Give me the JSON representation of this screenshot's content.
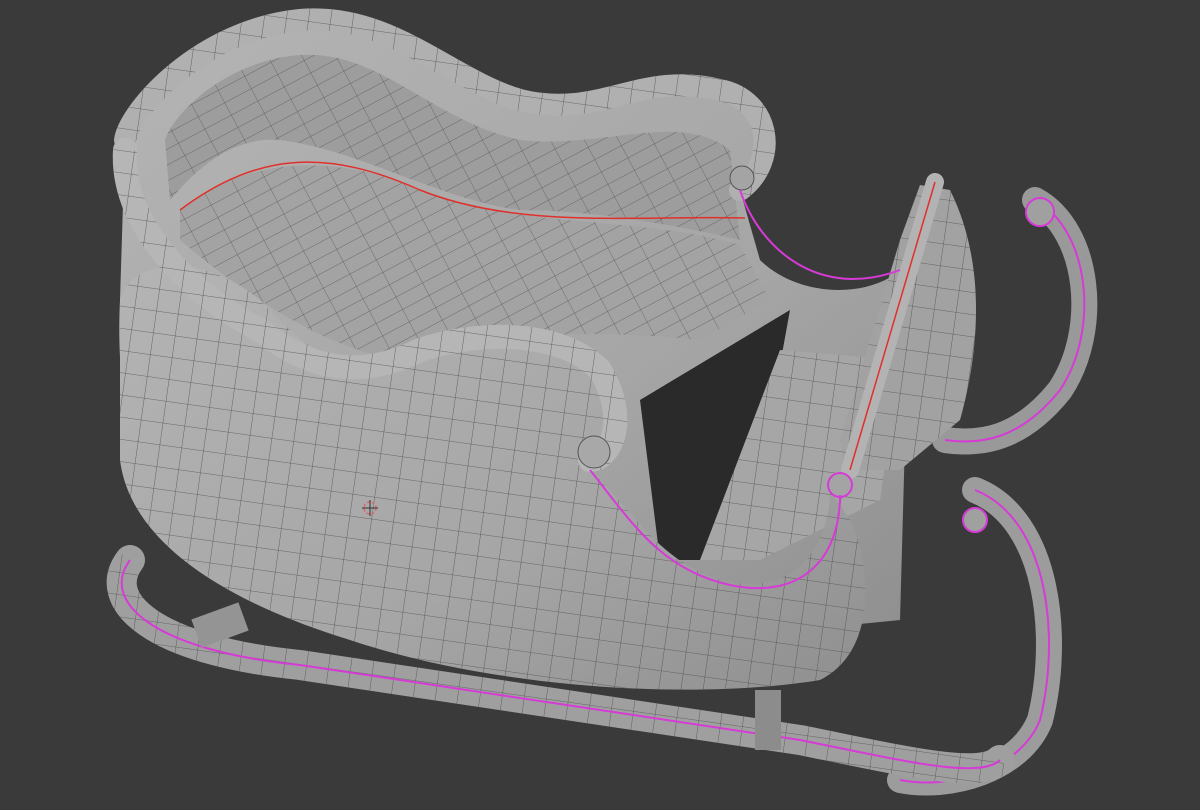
{
  "viewport": {
    "object": "sleigh-mesh",
    "mode": "wireframe-overlay",
    "colors": {
      "background": "#3a3a3a",
      "surface": "#a9a9a9",
      "surface_shadow": "#8a8a8a",
      "interior": "#9a9a9a",
      "wire": "#4a4a4a",
      "seam": "#e0302a",
      "selected_edge": "#d63bd6"
    },
    "icons": [
      "3d-cursor-icon"
    ]
  }
}
